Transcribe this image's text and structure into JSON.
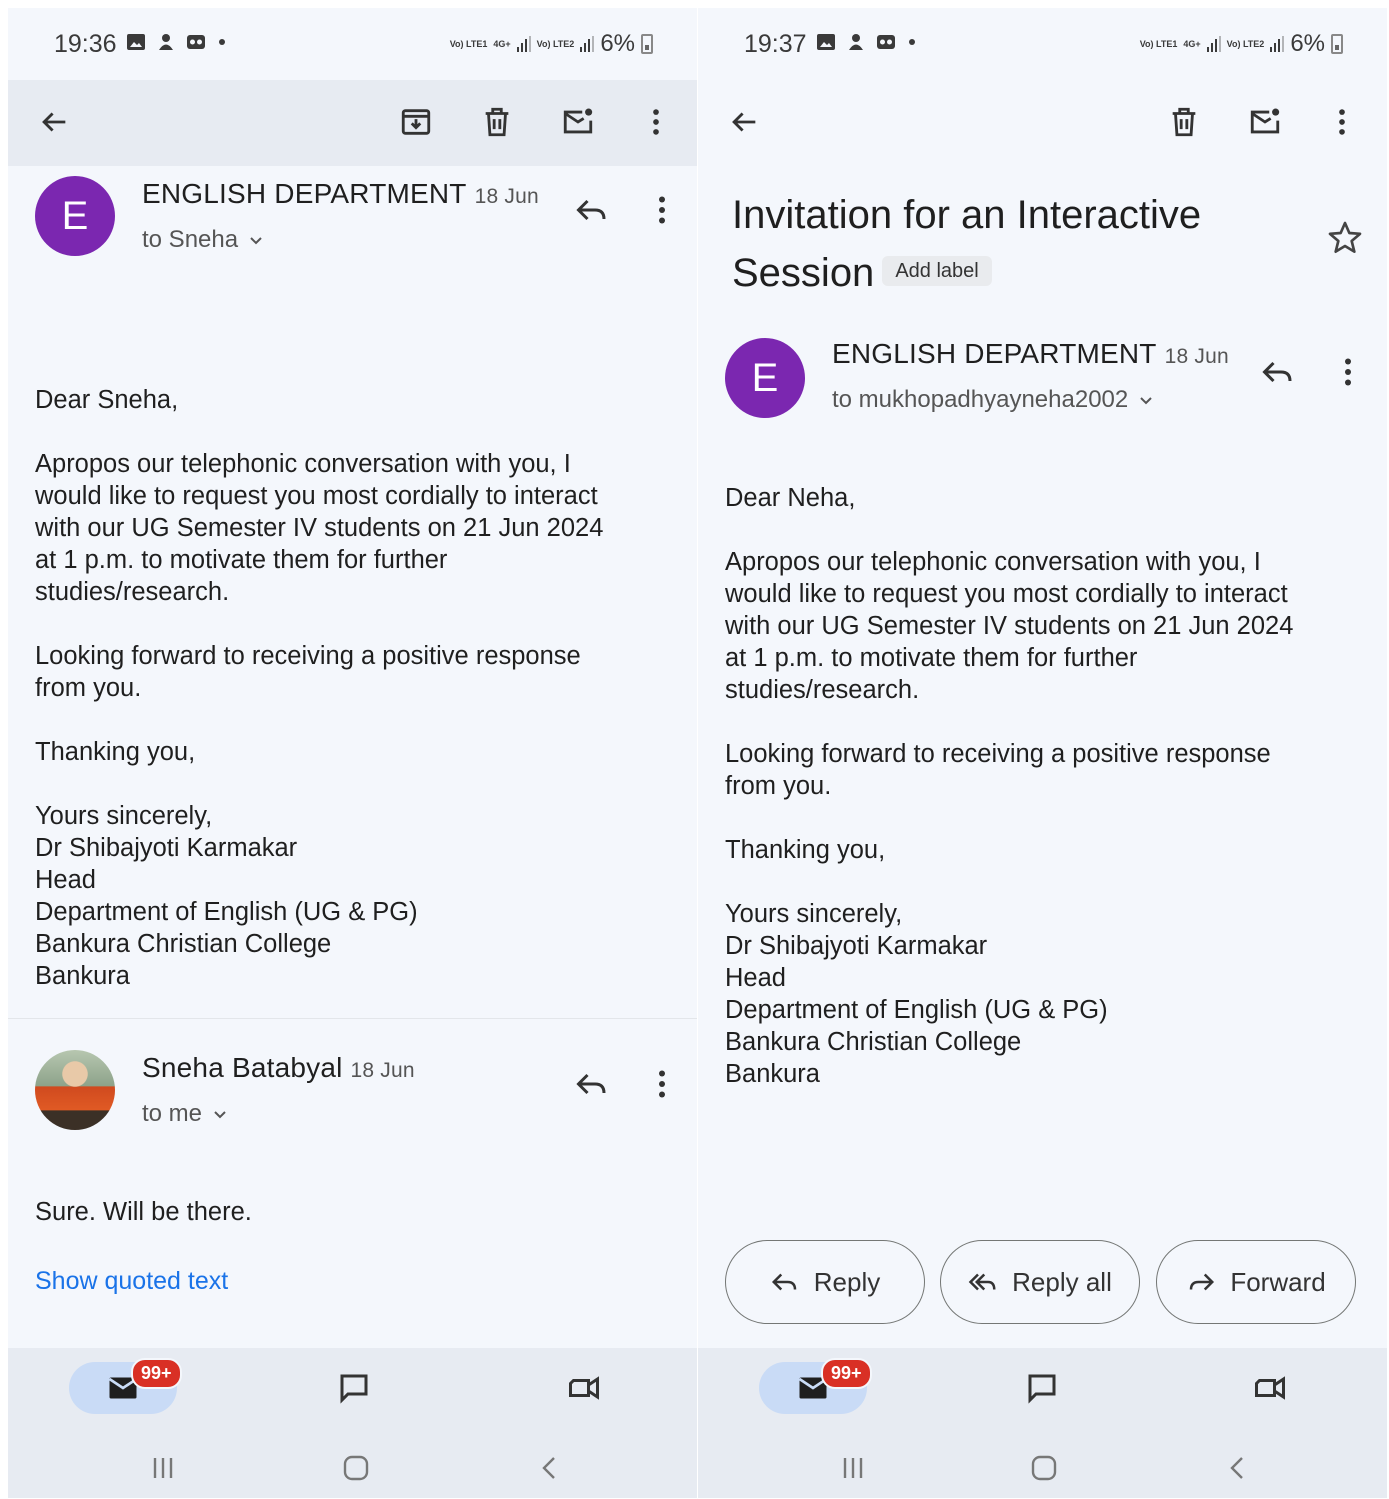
{
  "left": {
    "status": {
      "time": "19:36",
      "battery": "6%",
      "net1": "Vo) LTE1",
      "net2": "4G+",
      "net3": "Vo) LTE2"
    },
    "message1": {
      "avatar_letter": "E",
      "sender": "ENGLISH DEPARTMENT",
      "date": "18 Jun",
      "recipient": "to Sneha",
      "body": "Dear Sneha,\n\nApropos our telephonic conversation with you, I\nwould like to request you most cordially to interact\nwith our UG Semester IV students on 21 Jun 2024\nat 1 p.m. to motivate them for further\nstudies/research.\n\nLooking forward to receiving a positive response\nfrom you.\n\nThanking you,\n\nYours sincerely,\nDr Shibajyoti Karmakar\nHead\nDepartment of English (UG & PG)\nBankura Christian College\nBankura"
    },
    "message2": {
      "sender": "Sneha Batabyal",
      "date": "18 Jun",
      "recipient": "to me",
      "body": "Sure. Will be there.",
      "show_quoted": "Show quoted text"
    },
    "badge": "99+"
  },
  "right": {
    "status": {
      "time": "19:37",
      "battery": "6%",
      "net1": "Vo) LTE1",
      "net2": "4G+",
      "net3": "Vo) LTE2"
    },
    "subject": "Invitation for an Interactive Session",
    "add_label": "Add label",
    "message": {
      "avatar_letter": "E",
      "sender": "ENGLISH DEPARTMENT",
      "date": "18 Jun",
      "recipient": "to mukhopadhyayneha2002",
      "body": "Dear Neha,\n\nApropos our telephonic conversation with you, I\nwould like to request you most cordially to interact\nwith our UG Semester IV students on 21 Jun 2024\nat 1 p.m. to motivate them for further\nstudies/research.\n\nLooking forward to receiving a positive response\nfrom you.\n\nThanking you,\n\nYours sincerely,\nDr Shibajyoti Karmakar\nHead\nDepartment of English (UG & PG)\nBankura Christian College\nBankura"
    },
    "actions": {
      "reply": "Reply",
      "reply_all": "Reply all",
      "forward": "Forward"
    },
    "badge": "99+"
  },
  "colors": {
    "avatar": "#7b27b0",
    "link": "#1a73e8",
    "badge": "#d93025",
    "nav_pill": "#c9dbf6"
  }
}
